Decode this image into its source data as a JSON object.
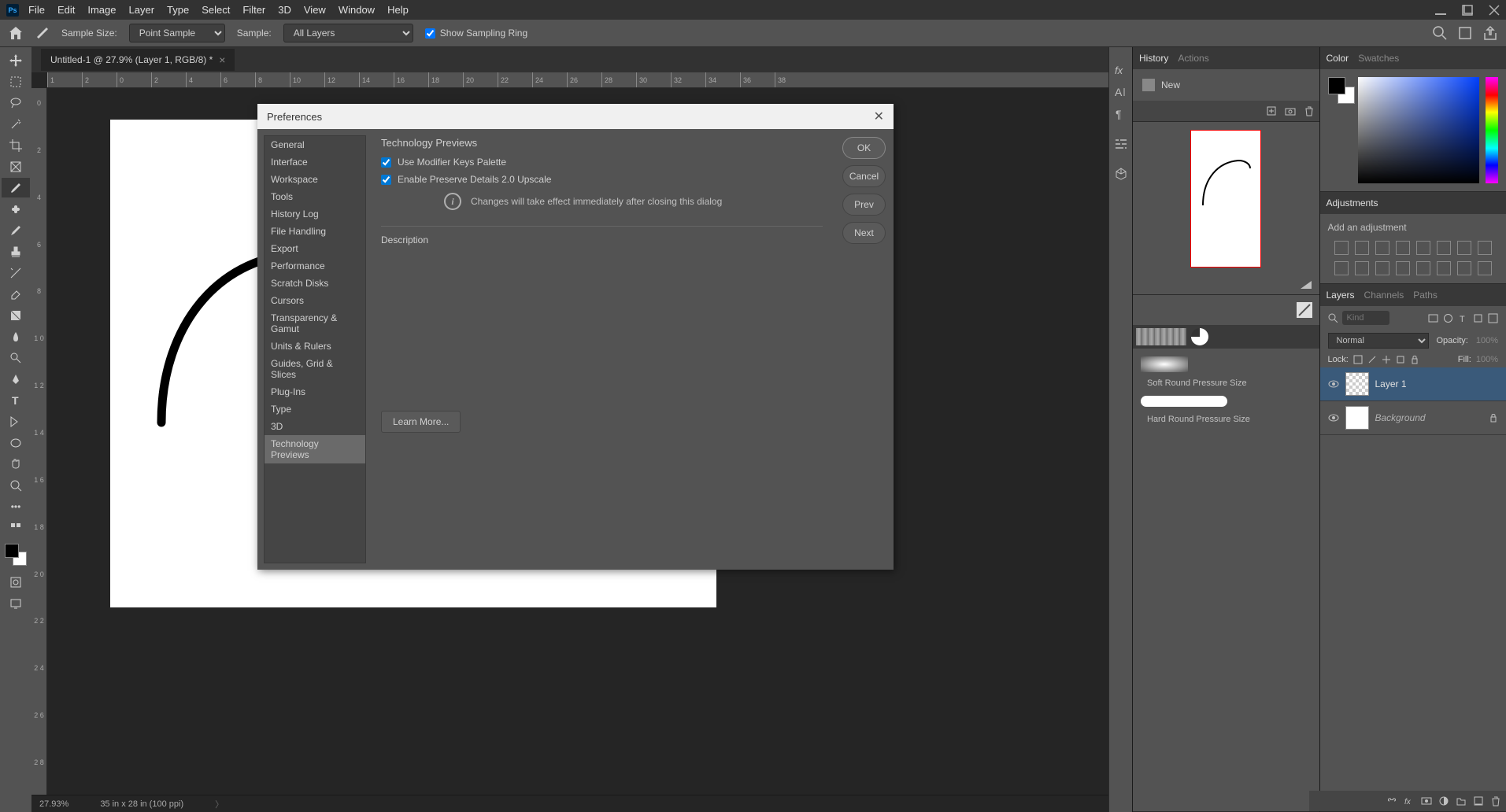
{
  "menu": [
    "File",
    "Edit",
    "Image",
    "Layer",
    "Type",
    "Select",
    "Filter",
    "3D",
    "View",
    "Window",
    "Help"
  ],
  "options": {
    "sample_size_label": "Sample Size:",
    "sample_size_value": "Point Sample",
    "sample_label": "Sample:",
    "sample_value": "All Layers",
    "show_ring": "Show Sampling Ring"
  },
  "doc_tab": "Untitled-1 @ 27.9% (Layer 1, RGB/8) *",
  "ruler_h": [
    "1",
    "2",
    "0",
    "2",
    "4",
    "6",
    "8",
    "10",
    "12",
    "14",
    "16",
    "18",
    "20",
    "22",
    "24",
    "26",
    "28",
    "30",
    "32",
    "34",
    "36",
    "38"
  ],
  "ruler_v": [
    "0",
    "2",
    "4",
    "6",
    "8",
    "1\n0",
    "1\n2",
    "1\n4",
    "1\n6",
    "1\n8",
    "2\n0",
    "2\n2",
    "2\n4",
    "2\n6",
    "2\n8"
  ],
  "status": {
    "zoom": "27.93%",
    "dims": "35 in x 28 in (100 ppi)"
  },
  "panels": {
    "history_tab": "History",
    "actions_tab": "Actions",
    "history_item": "New",
    "color_tab": "Color",
    "swatches_tab": "Swatches",
    "adjustments_tab": "Adjustments",
    "adj_label": "Add an adjustment",
    "layers_tab": "Layers",
    "channels_tab": "Channels",
    "paths_tab": "Paths",
    "layer_kind": "Kind",
    "blend_mode": "Normal",
    "opacity_label": "Opacity:",
    "opacity_value": "100%",
    "lock_label": "Lock:",
    "fill_label": "Fill:",
    "fill_value": "100%",
    "layer1": "Layer 1",
    "bg_layer": "Background",
    "brush1": "Soft Round Pressure Size",
    "brush2": "Hard Round Pressure Size"
  },
  "dialog": {
    "title": "Preferences",
    "categories": [
      "General",
      "Interface",
      "Workspace",
      "Tools",
      "History Log",
      "File Handling",
      "Export",
      "Performance",
      "Scratch Disks",
      "Cursors",
      "Transparency & Gamut",
      "Units & Rulers",
      "Guides, Grid & Slices",
      "Plug-Ins",
      "Type",
      "3D",
      "Technology Previews"
    ],
    "section": "Technology Previews",
    "check1": "Use Modifier Keys Palette",
    "check2": "Enable Preserve Details 2.0 Upscale",
    "info": "Changes will take effect immediately after closing this dialog",
    "desc_label": "Description",
    "learn": "Learn More...",
    "ok": "OK",
    "cancel": "Cancel",
    "prev": "Prev",
    "next": "Next"
  }
}
